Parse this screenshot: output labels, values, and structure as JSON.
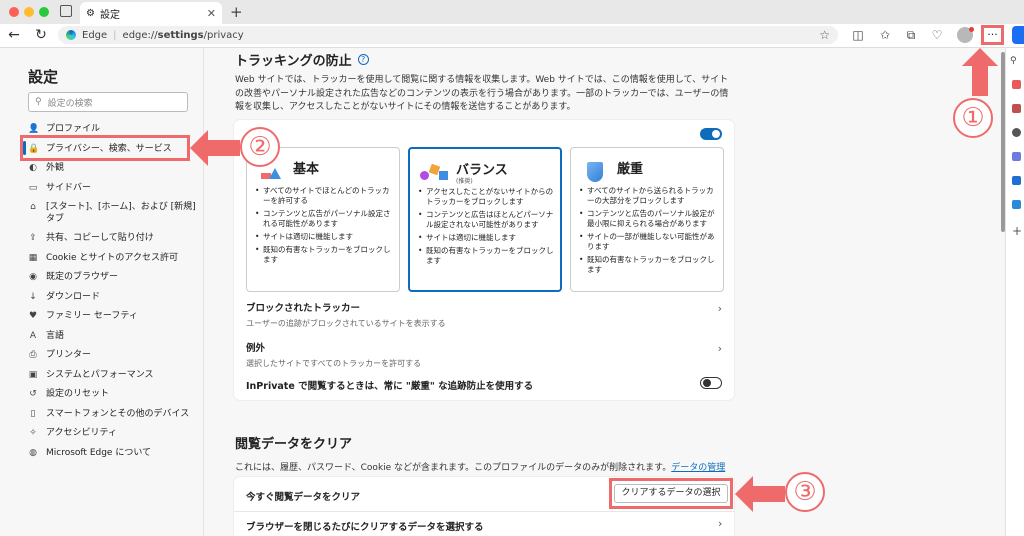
{
  "browser": {
    "tab_title": "設定",
    "tab_close": "✕",
    "new_tab": "+",
    "url_brand": "Edge",
    "url_prefix": "edge://",
    "url_bold": "settings",
    "url_suffix": "/privacy",
    "more_menu": "···"
  },
  "sidebar": {
    "title": "設定",
    "search_placeholder": "設定の検索",
    "items": [
      {
        "label": "プロファイル",
        "icon": "profile-icon"
      },
      {
        "label": "プライバシー、検索、サービス",
        "icon": "lock-icon"
      },
      {
        "label": "外観",
        "icon": "appearance-icon"
      },
      {
        "label": "サイドバー",
        "icon": "sidebar-icon"
      },
      {
        "label": "[スタート]、[ホーム]、および [新規] タブ",
        "icon": "home-icon"
      },
      {
        "label": "共有、コピーして貼り付け",
        "icon": "share-icon"
      },
      {
        "label": "Cookie とサイトのアクセス許可",
        "icon": "cookie-icon"
      },
      {
        "label": "既定のブラウザー",
        "icon": "browser-icon"
      },
      {
        "label": "ダウンロード",
        "icon": "download-icon"
      },
      {
        "label": "ファミリー セーフティ",
        "icon": "family-icon"
      },
      {
        "label": "言語",
        "icon": "language-icon"
      },
      {
        "label": "プリンター",
        "icon": "printer-icon"
      },
      {
        "label": "システムとパフォーマンス",
        "icon": "system-icon"
      },
      {
        "label": "設定のリセット",
        "icon": "reset-icon"
      },
      {
        "label": "スマートフォンとその他のデバイス",
        "icon": "phone-icon"
      },
      {
        "label": "アクセシビリティ",
        "icon": "accessibility-icon"
      },
      {
        "label": "Microsoft Edge について",
        "icon": "edge-icon"
      }
    ]
  },
  "tracking": {
    "title": "トラッキングの防止",
    "help": "?",
    "description": "Web サイトでは、トラッカーを使用して閲覧に関する情報を収集します。Web サイトでは、この情報を使用して、サイトの改善やパーソナル設定された広告などのコンテンツの表示を行う場合があります。一部のトラッカーでは、ユーザーの情報を収集し、アクセスしたことがないサイトにその情報を送信することがあります。",
    "enabled": true,
    "levels": [
      {
        "name": "基本",
        "sub": "",
        "selected": false,
        "bullets": [
          "すべてのサイトでほとんどのトラッカーを許可する",
          "コンテンツと広告がパーソナル設定される可能性があります",
          "サイトは適切に機能します",
          "既知の有害なトラッカーをブロックします"
        ]
      },
      {
        "name": "バランス",
        "sub": "(推奨)",
        "selected": true,
        "bullets": [
          "アクセスしたことがないサイトからのトラッカーをブロックします",
          "コンテンツと広告はほとんどパーソナル設定されない可能性があります",
          "サイトは適切に機能します",
          "既知の有害なトラッカーをブロックします"
        ]
      },
      {
        "name": "厳重",
        "sub": "",
        "selected": false,
        "bullets": [
          "すべてのサイトから送られるトラッカーの大部分をブロックします",
          "コンテンツと広告のパーソナル設定が最小限に抑えられる場合があります",
          "サイトの一部が機能しない可能性があります",
          "既知の有害なトラッカーをブロックします"
        ]
      }
    ],
    "blocked_title": "ブロックされたトラッカー",
    "blocked_sub": "ユーザーの追跡がブロックされているサイトを表示する",
    "exceptions_title": "例外",
    "exceptions_sub": "選択したサイトですべてのトラッカーを許可する",
    "inprivate_label": "InPrivate で閲覧するときは、常に \"厳重\" な追跡防止を使用する",
    "inprivate_enabled": false
  },
  "clear_data": {
    "title": "閲覧データをクリア",
    "description": "これには、履歴、パスワード、Cookie などが含まれます。このプロファイルのデータのみが削除されます。",
    "manage_link": "データの管理",
    "clear_now_label": "今すぐ閲覧データをクリア",
    "clear_button": "クリアするデータの選択",
    "on_close_label": "ブラウザーを閉じるたびにクリアするデータを選択する"
  },
  "annotations": {
    "one": "①",
    "two": "②",
    "three": "③"
  },
  "colors": {
    "accent": "#0f6cbd",
    "annotation": "#ef6b6b"
  }
}
